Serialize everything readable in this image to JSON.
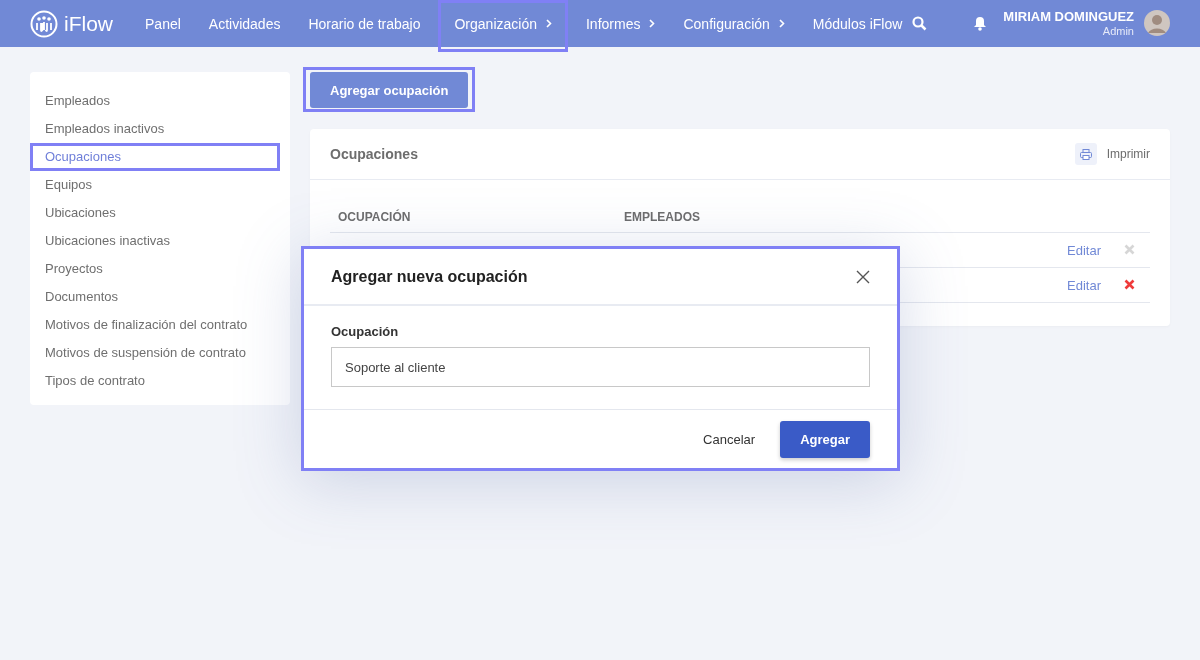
{
  "header": {
    "logo": "iFlow",
    "nav": [
      {
        "label": "Panel",
        "has_submenu": false,
        "highlighted": false
      },
      {
        "label": "Actividades",
        "has_submenu": false,
        "highlighted": false
      },
      {
        "label": "Horario de trabajo",
        "has_submenu": false,
        "highlighted": false
      },
      {
        "label": "Organización",
        "has_submenu": true,
        "highlighted": true
      },
      {
        "label": "Informes",
        "has_submenu": true,
        "highlighted": false
      },
      {
        "label": "Configuración",
        "has_submenu": true,
        "highlighted": false
      },
      {
        "label": "Módulos iFlow",
        "has_submenu": false,
        "highlighted": false
      }
    ],
    "user": {
      "name": "MIRIAM DOMINGUEZ",
      "role": "Admin"
    }
  },
  "sidebar": {
    "items": [
      {
        "label": "Empleados",
        "selected": false,
        "highlighted": false
      },
      {
        "label": "Empleados inactivos",
        "selected": false,
        "highlighted": false
      },
      {
        "label": "Ocupaciones",
        "selected": true,
        "highlighted": true
      },
      {
        "label": "Equipos",
        "selected": false,
        "highlighted": false
      },
      {
        "label": "Ubicaciones",
        "selected": false,
        "highlighted": false
      },
      {
        "label": "Ubicaciones inactivas",
        "selected": false,
        "highlighted": false
      },
      {
        "label": "Proyectos",
        "selected": false,
        "highlighted": false
      },
      {
        "label": "Documentos",
        "selected": false,
        "highlighted": false
      },
      {
        "label": "Motivos de finalización del contrato",
        "selected": false,
        "highlighted": false
      },
      {
        "label": "Motivos de suspensión de contrato",
        "selected": false,
        "highlighted": false
      },
      {
        "label": "Tipos de contrato",
        "selected": false,
        "highlighted": false
      }
    ]
  },
  "add_button": {
    "label": "Agregar ocupación",
    "highlighted": true
  },
  "panel": {
    "title": "Ocupaciones",
    "print": "Imprimir",
    "table": {
      "columns": [
        "OCUPACIÓN",
        "EMPLEADOS"
      ],
      "rows": [
        {
          "action": "Editar",
          "deletable": false
        },
        {
          "action": "Editar",
          "deletable": true
        }
      ]
    }
  },
  "dialog": {
    "title": "Agregar nueva ocupación",
    "highlighted": true,
    "field_label": "Ocupación",
    "field_value": "Soporte al cliente",
    "cancel": "Cancelar",
    "submit": "Agregar"
  }
}
